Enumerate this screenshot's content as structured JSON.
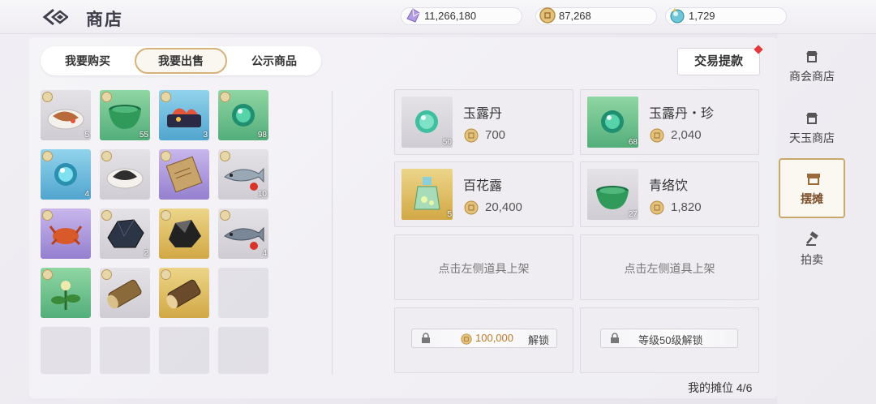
{
  "header": {
    "title": "商店"
  },
  "currencies": [
    {
      "name": "crystal",
      "value": "11,266,180"
    },
    {
      "name": "coin",
      "value": "87,268"
    },
    {
      "name": "jade",
      "value": "1,729"
    }
  ],
  "tabs": [
    {
      "label": "我要购买"
    },
    {
      "label": "我要出售",
      "active": true
    },
    {
      "label": "公示商品"
    }
  ],
  "inventory": {
    "items": [
      {
        "name": "grilled-fish-dish",
        "rarity": "gray",
        "count": "5"
      },
      {
        "name": "jade-bowl",
        "rarity": "green",
        "count": "55"
      },
      {
        "name": "sashimi-platter",
        "rarity": "blue",
        "count": "3"
      },
      {
        "name": "jade-pearl",
        "rarity": "green",
        "count": "98"
      },
      {
        "name": "blue-pearl",
        "rarity": "blue",
        "count": "4"
      },
      {
        "name": "dark-herb-dish",
        "rarity": "gray",
        "count": ""
      },
      {
        "name": "wooden-manual",
        "rarity": "purple",
        "count": ""
      },
      {
        "name": "silver-fish",
        "rarity": "gray",
        "count": "10"
      },
      {
        "name": "red-crab",
        "rarity": "purple",
        "count": ""
      },
      {
        "name": "dark-ore",
        "rarity": "gray",
        "count": "2"
      },
      {
        "name": "black-ore",
        "rarity": "gold",
        "count": ""
      },
      {
        "name": "grey-fish",
        "rarity": "gray",
        "count": "4"
      },
      {
        "name": "green-herb",
        "rarity": "green",
        "count": ""
      },
      {
        "name": "wood-log",
        "rarity": "gray",
        "count": ""
      },
      {
        "name": "golden-log",
        "rarity": "gold",
        "count": ""
      }
    ]
  },
  "withdraw_label": "交易提款",
  "stalls": [
    {
      "name": "玉露丹",
      "price": "700",
      "qty": "50",
      "rarity": "gray"
    },
    {
      "name": "玉露丹・珍",
      "price": "2,040",
      "qty": "68",
      "rarity": "green"
    },
    {
      "name": "百花露",
      "price": "20,400",
      "qty": "5",
      "rarity": "gold"
    },
    {
      "name": "青络饮",
      "price": "1,820",
      "qty": "27",
      "rarity": "gray"
    }
  ],
  "empty_stall_text": "点击左侧道具上架",
  "locked": {
    "price": "100,000",
    "unlock": "解锁",
    "level_unlock": "等级50级解锁"
  },
  "stall_count_label": "我的摊位 4/6",
  "sidebar": [
    {
      "label": "商会商店"
    },
    {
      "label": "天玉商店"
    },
    {
      "label": "摆摊",
      "active": true
    },
    {
      "label": "拍卖"
    }
  ]
}
